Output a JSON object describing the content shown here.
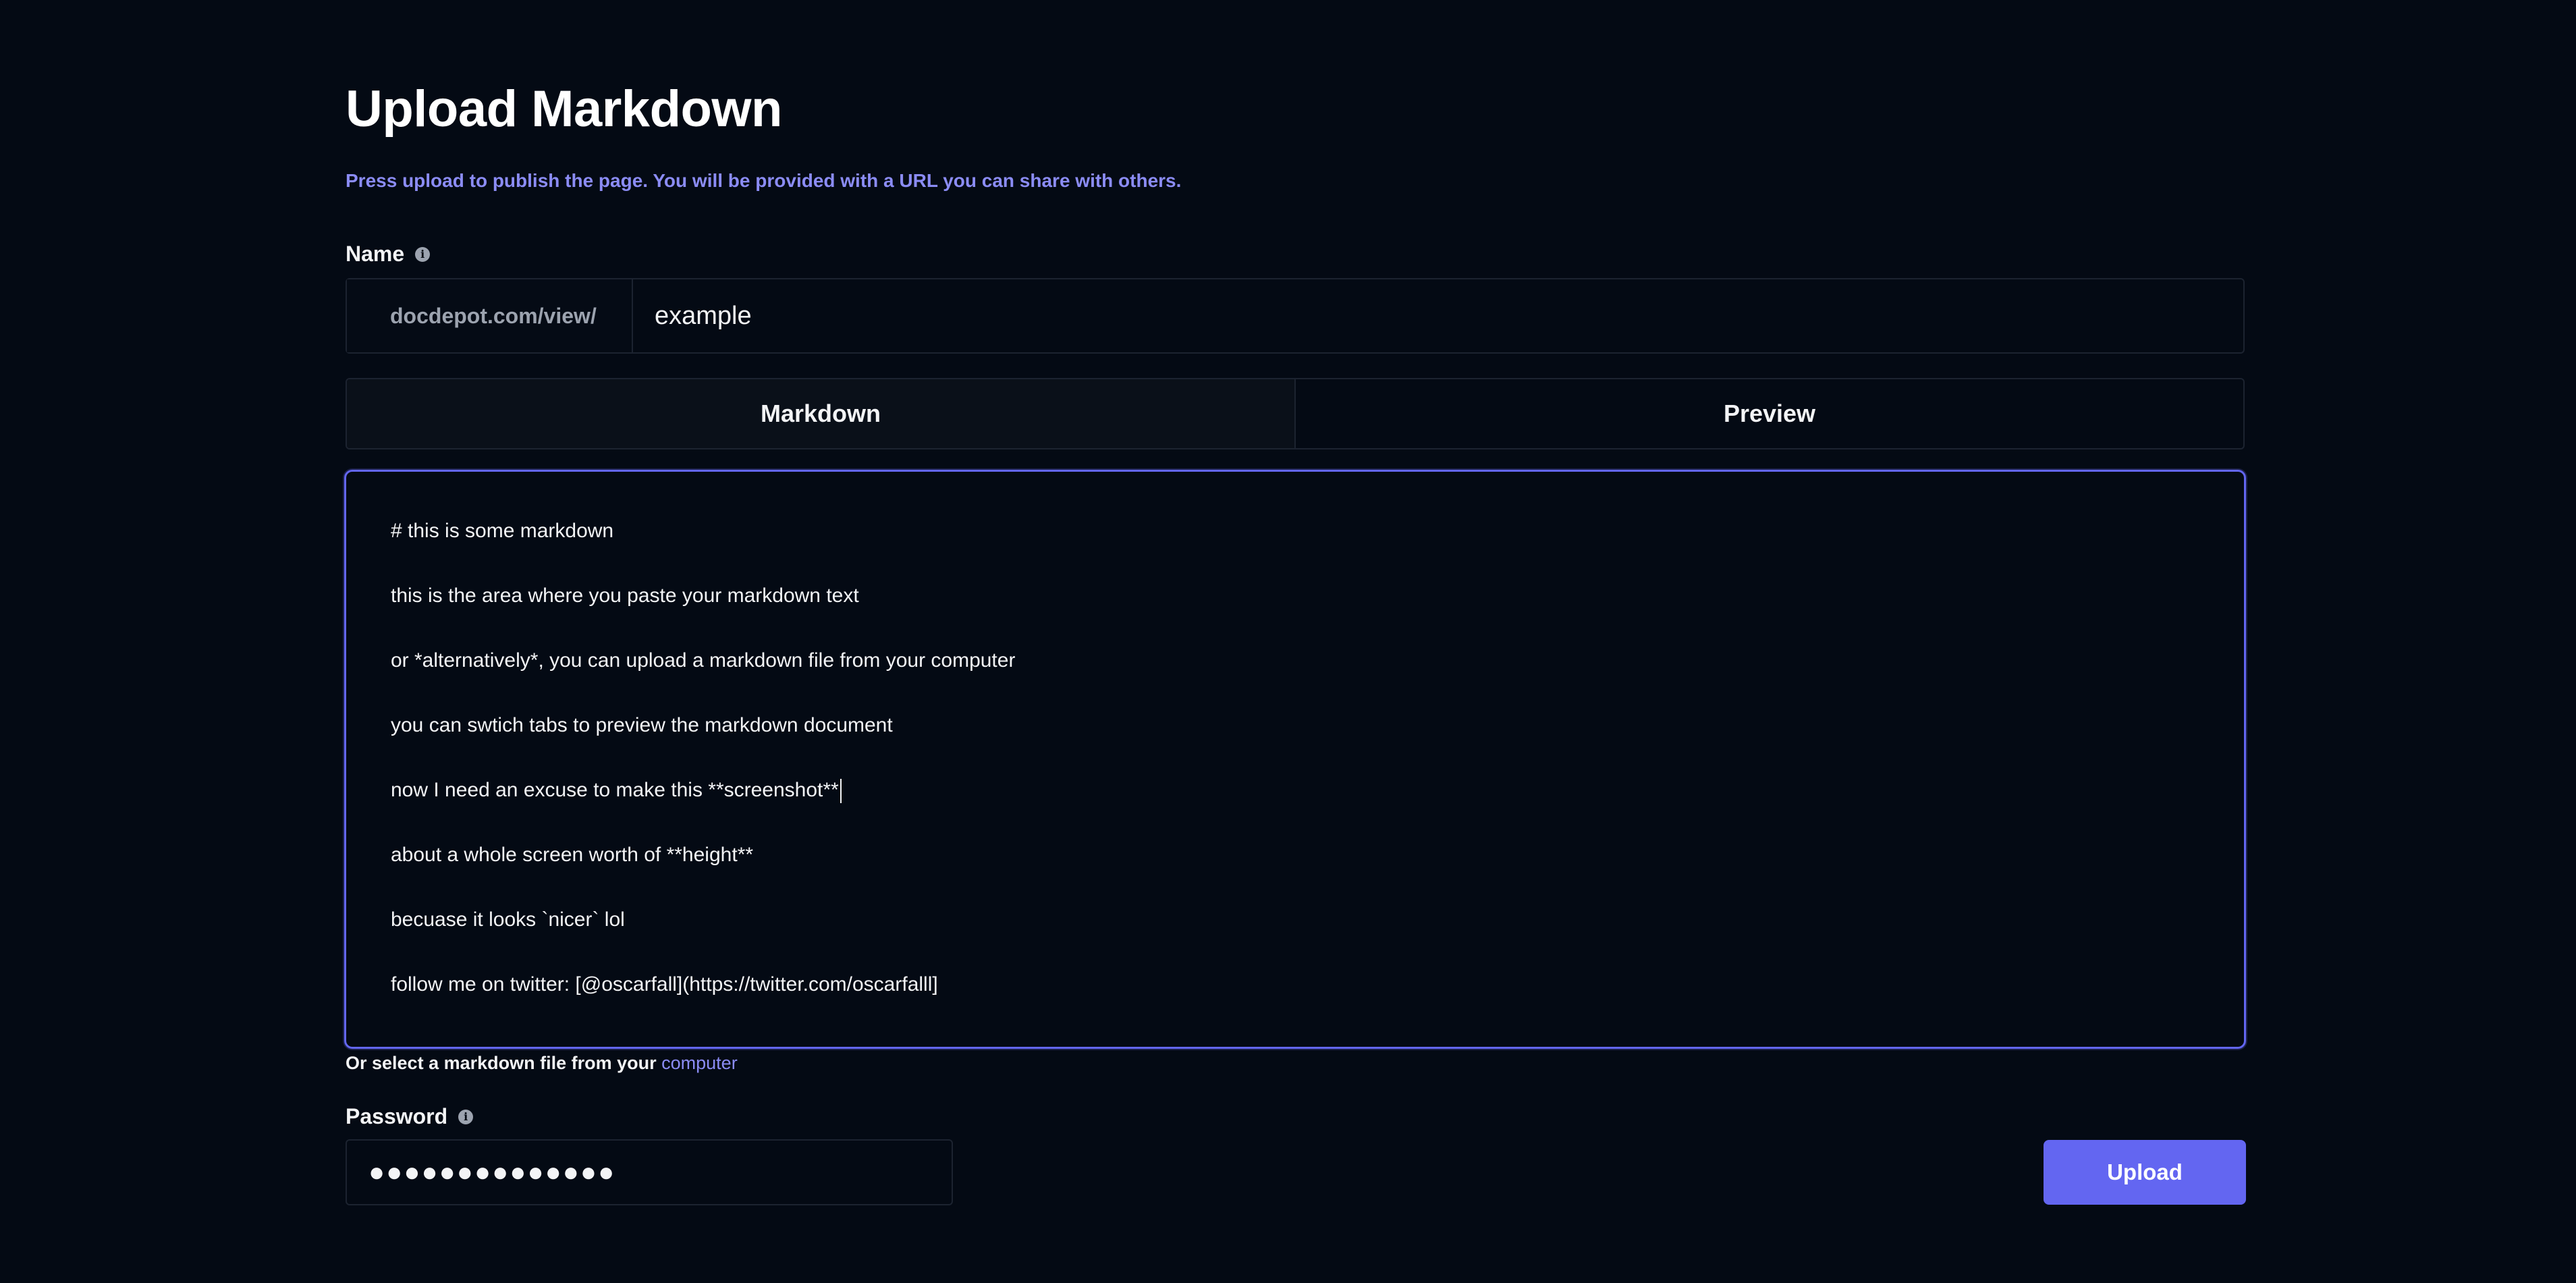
{
  "header": {
    "title": "Upload Markdown",
    "subtitle": "Press upload to publish the page. You will be provided with a URL you can share with others."
  },
  "name_field": {
    "label": "Name",
    "prefix": "docdepot.com/view/",
    "value": "example",
    "info_icon": "info-icon"
  },
  "tabs": [
    {
      "label": "Markdown",
      "active": true
    },
    {
      "label": "Preview",
      "active": false
    }
  ],
  "editor": {
    "lines": [
      "# this is some markdown",
      "this is the area where you paste your markdown text",
      "or *alternatively*, you can upload a markdown file from your computer",
      "you can swtich tabs to preview the markdown document",
      "now I need an excuse to make this **screenshot**",
      "about a whole screen worth of **height**",
      "becuase it looks `nicer` lol",
      "follow me on twitter: [@oscarfall](https://twitter.com/oscarfalll]"
    ]
  },
  "file_hint": {
    "text": "Or select a markdown file from your ",
    "link": "computer"
  },
  "password_field": {
    "label": "Password",
    "value": "●●●●●●●●●●●●●●",
    "info_icon": "info-icon"
  },
  "actions": {
    "upload_label": "Upload"
  },
  "colors": {
    "background": "#040a14",
    "accent": "#6366f1",
    "link": "#8b8cf5",
    "border": "#1c2330"
  }
}
